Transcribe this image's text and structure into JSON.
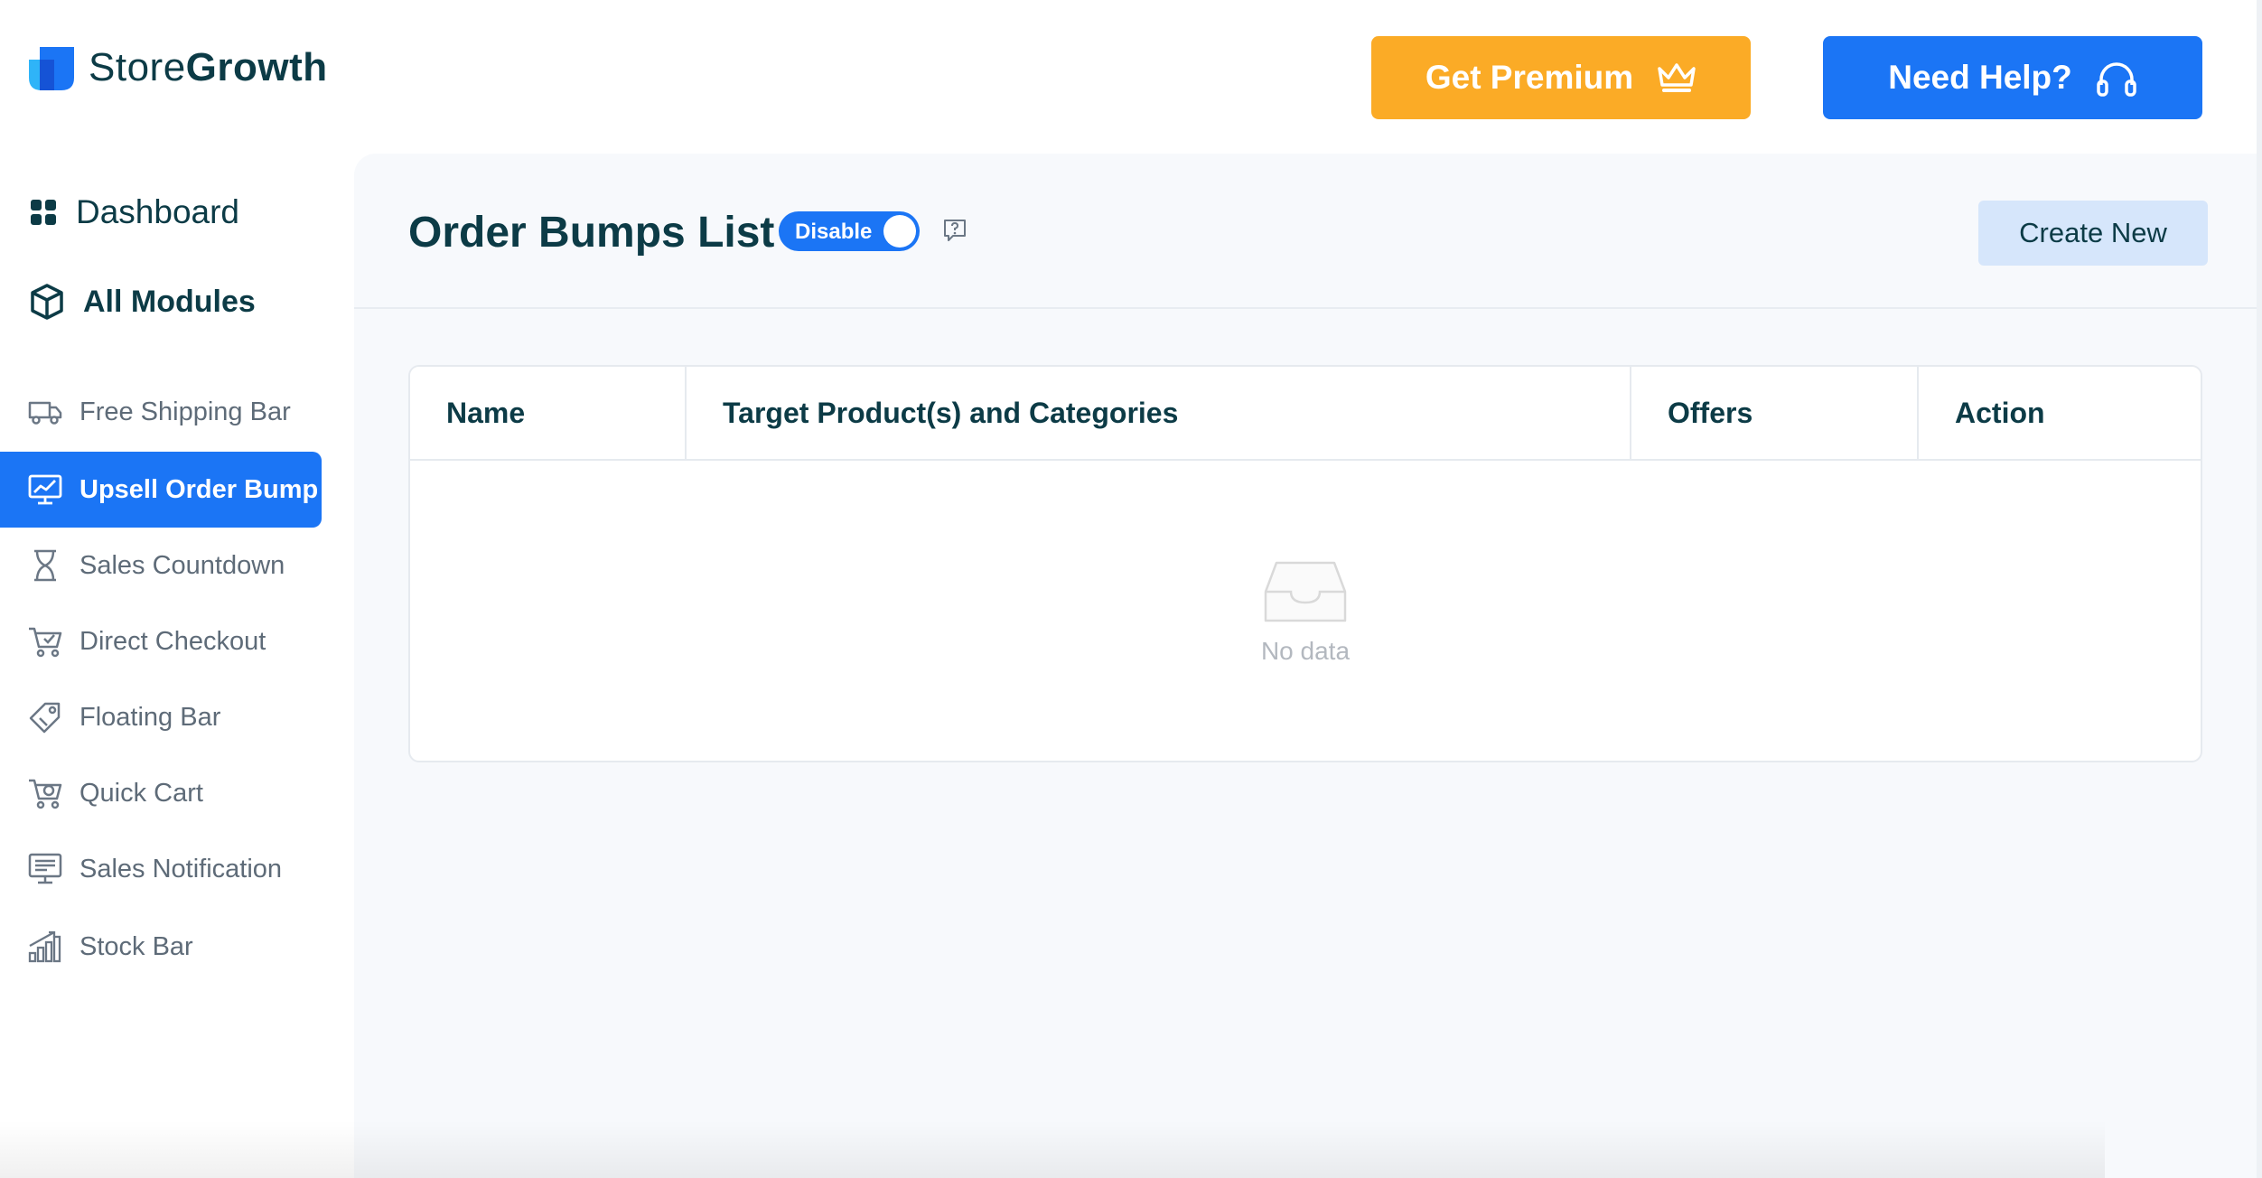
{
  "brand": {
    "name_part1": "Store",
    "name_part2": "Growth",
    "accent": "#1b75f5"
  },
  "header": {
    "premium_label": "Get Premium",
    "premium_icon": "crown-icon",
    "premium_color": "#fbab26",
    "help_label": "Need Help?",
    "help_icon": "headset-icon",
    "help_color": "#1b75f5"
  },
  "sidebar": {
    "dashboard": {
      "label": "Dashboard",
      "icon": "grid-icon"
    },
    "modules": {
      "label": "All Modules",
      "icon": "cube-icon"
    },
    "items": [
      {
        "label": "Free Shipping Bar",
        "icon": "truck-icon",
        "active": false
      },
      {
        "label": "Upsell Order Bump",
        "icon": "chart-monitor-icon",
        "active": true
      },
      {
        "label": "Sales Countdown",
        "icon": "hourglass-icon",
        "active": false
      },
      {
        "label": "Direct Checkout",
        "icon": "cart-icon",
        "active": false
      },
      {
        "label": "Floating Bar",
        "icon": "tag-icon",
        "active": false
      },
      {
        "label": "Quick Cart",
        "icon": "cart-icon",
        "active": false
      },
      {
        "label": "Sales Notification",
        "icon": "notification-icon",
        "active": false
      },
      {
        "label": "Stock Bar",
        "icon": "bar-chart-icon",
        "active": false
      }
    ]
  },
  "main": {
    "title": "Order Bumps List",
    "toggle_label": "Disable",
    "help_tooltip_icon": "question-comment-icon",
    "create_label": "Create New",
    "table": {
      "columns": [
        "Name",
        "Target Product(s) and Categories",
        "Offers",
        "Action"
      ],
      "empty_text": "No data",
      "empty_icon": "inbox-icon"
    }
  }
}
